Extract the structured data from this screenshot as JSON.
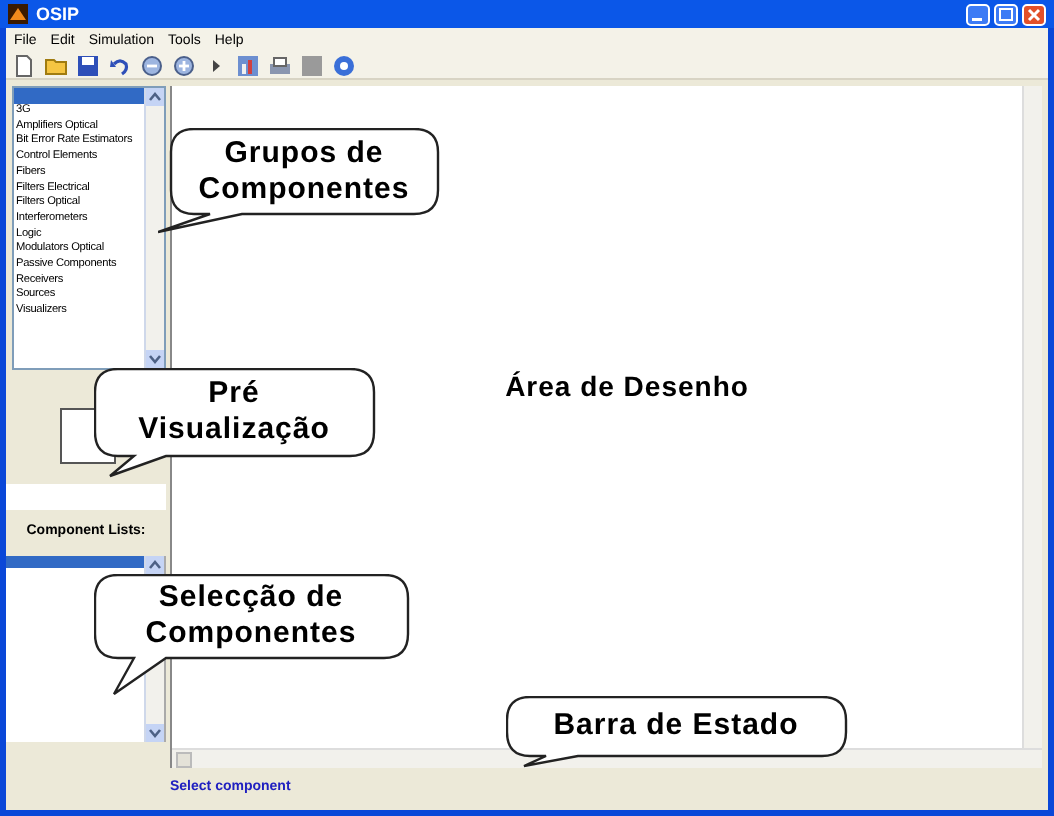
{
  "window": {
    "title": "OSIP"
  },
  "menu": [
    "File",
    "Edit",
    "Simulation",
    "Tools",
    "Help"
  ],
  "groups_list": {
    "blank_row_selected": true,
    "items": [
      "3G",
      "Amplifiers Optical",
      "Bit Error Rate Estimators",
      "Control Elements",
      "Fibers",
      "Filters Electrical",
      "Filters Optical",
      "Interferometers",
      "Logic",
      "Modulators Optical",
      "Passive Components",
      "Receivers",
      "Sources",
      "Visualizers"
    ]
  },
  "component_lists": {
    "label": "Component Lists:",
    "blank_row_selected": true
  },
  "canvas": {
    "label": "Área de Desenho"
  },
  "status_bar": {
    "text": "Select component"
  },
  "callouts": [
    {
      "lines": [
        "Grupos de",
        "Componentes"
      ]
    },
    {
      "lines": [
        "Pré",
        "Visualização"
      ]
    },
    {
      "lines": [
        "Selecção de",
        "Componentes"
      ]
    },
    {
      "lines": [
        "Barra de Estado"
      ]
    }
  ]
}
